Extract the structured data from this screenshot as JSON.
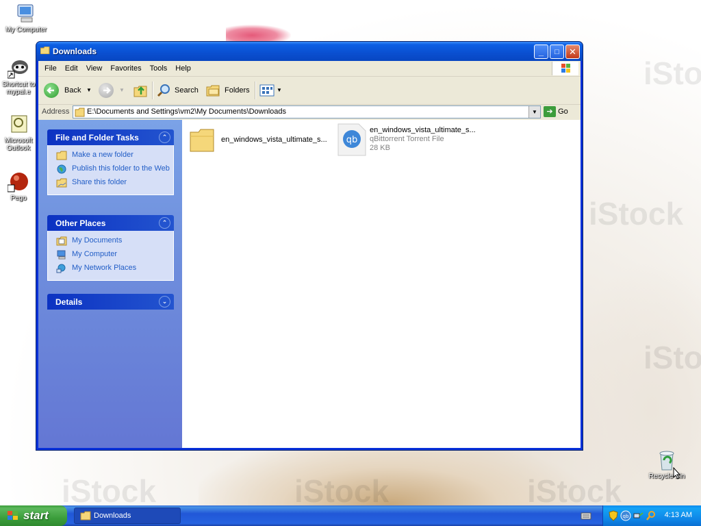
{
  "desktop": {
    "icons": [
      {
        "label": "My Computer",
        "icon": "my-computer-icon"
      },
      {
        "label": "Shortcut to mypal.e",
        "icon": "raccoon-shortcut-icon"
      },
      {
        "label": "Microsoft Outlook",
        "icon": "outlook-icon"
      },
      {
        "label": "Pego",
        "icon": "red-ball-icon"
      },
      {
        "label": "Recycle Bin",
        "icon": "recycle-bin-icon"
      }
    ],
    "watermark": "iStock"
  },
  "window": {
    "title": "Downloads",
    "controls": {
      "minimize": "_",
      "maximize": "□",
      "close": "✕"
    }
  },
  "menu": [
    "File",
    "Edit",
    "View",
    "Favorites",
    "Tools",
    "Help"
  ],
  "toolbar": {
    "back": "Back",
    "search": "Search",
    "folders": "Folders"
  },
  "address": {
    "label": "Address",
    "path": "E:\\Documents and Settings\\vm2\\My Documents\\Downloads",
    "go": "Go"
  },
  "tasks": {
    "file_folder": {
      "title": "File and Folder Tasks",
      "items": [
        "Make a new folder",
        "Publish this folder to the Web",
        "Share this folder"
      ]
    },
    "other_places": {
      "title": "Other Places",
      "items": [
        "My Documents",
        "My Computer",
        "My Network Places"
      ]
    },
    "details": {
      "title": "Details"
    }
  },
  "files": [
    {
      "name": "en_windows_vista_ultimate_s...",
      "type": "folder"
    },
    {
      "name": "en_windows_vista_ultimate_s...",
      "subtype": "qBittorrent Torrent File",
      "size": "28 KB"
    }
  ],
  "taskbar": {
    "start": "start",
    "task": "Downloads",
    "clock": "4:13 AM"
  },
  "colors": {
    "title_blue": "#0a4fd0",
    "start_green": "#3c9e3c",
    "task_link": "#215dc6"
  }
}
